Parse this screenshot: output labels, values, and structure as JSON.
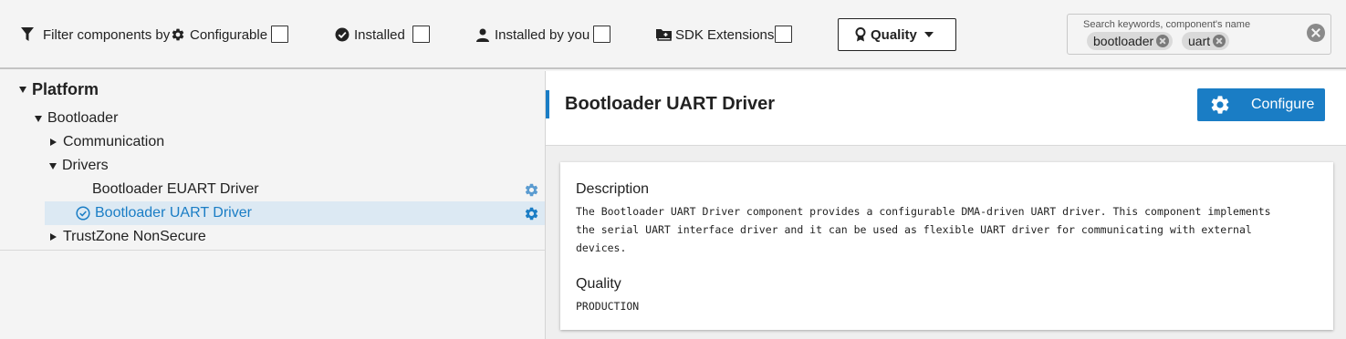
{
  "filters": {
    "title": "Filter components by",
    "filter_icon": "filter-icon",
    "options": [
      {
        "label": "Configurable",
        "icon": "gear-icon",
        "checked": false
      },
      {
        "label": "Installed",
        "icon": "check-circle-icon",
        "checked": false
      },
      {
        "label": "Installed by you",
        "icon": "person-icon",
        "checked": false
      },
      {
        "label": "SDK Extensions",
        "icon": "folder-plus-icon",
        "checked": false
      }
    ],
    "quality_dropdown": {
      "label": "Quality",
      "icon": "award-icon"
    }
  },
  "search": {
    "placeholder": "Search keywords, component's name",
    "tags": [
      "bootloader",
      "uart"
    ]
  },
  "tree": {
    "root": "Platform",
    "items": [
      {
        "label": "Bootloader",
        "state": "expanded"
      },
      {
        "label": "Communication",
        "state": "collapsed"
      },
      {
        "label": "Drivers",
        "state": "expanded"
      },
      {
        "label": "Bootloader EUART Driver",
        "configurable": true,
        "installed": false
      },
      {
        "label": "Bootloader UART Driver",
        "configurable": true,
        "installed": true,
        "selected": true
      },
      {
        "label": "TrustZone NonSecure",
        "state": "collapsed"
      }
    ]
  },
  "detail": {
    "title": "Bootloader UART Driver",
    "configure_label": "Configure",
    "description_heading": "Description",
    "description_lines": [
      "The Bootloader UART Driver component provides a configurable DMA-driven UART driver. This component implements",
      "the serial UART interface driver and it can be used as flexible UART driver for communicating with external",
      "devices."
    ],
    "quality_heading": "Quality",
    "quality_value": "PRODUCTION"
  },
  "colors": {
    "accent": "#1a7dc5",
    "selected_row_bg": "#dce9f3"
  }
}
